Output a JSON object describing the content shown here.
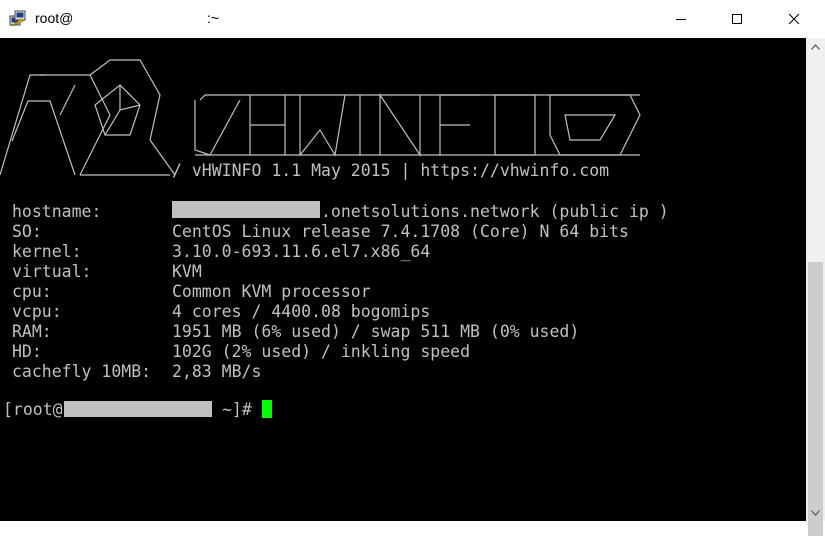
{
  "window": {
    "title_user": "root@",
    "title_path": ":~"
  },
  "logo": {
    "banner": "/ vHWINFO 1.1 May 2015 | https://vhwinfo.com"
  },
  "info": [
    {
      "label": "hostname:",
      "value": ".onetsolutions.network (public ip )"
    },
    {
      "label": "SO:",
      "value": "CentOS Linux release 7.4.1708 (Core) N 64 bits"
    },
    {
      "label": "kernel:",
      "value": "3.10.0-693.11.6.el7.x86_64"
    },
    {
      "label": "virtual:",
      "value": "KVM"
    },
    {
      "label": "cpu:",
      "value": "Common KVM processor"
    },
    {
      "label": "vcpu:",
      "value": "4 cores / 4400.08 bogomips"
    },
    {
      "label": "RAM:",
      "value": "1951 MB (6% used) / swap 511 MB (0% used)"
    },
    {
      "label": "HD:",
      "value": "102G (2% used) / inkling speed"
    },
    {
      "label": "cachefly 10MB:",
      "value": "2,83 MB/s"
    }
  ],
  "prompt": {
    "open": "[root@",
    "close": "~]#"
  },
  "colors": {
    "terminal_bg": "#000000",
    "terminal_fg": "#c0c0c0",
    "cursor": "#00ff00"
  }
}
